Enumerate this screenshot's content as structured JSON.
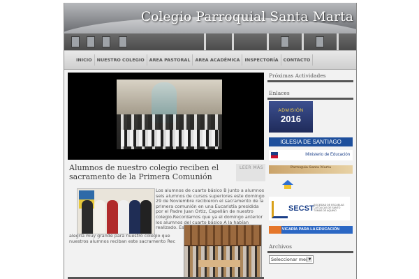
{
  "site": {
    "title": "Colegio Parroquial Santa Marta"
  },
  "nav": {
    "items": [
      "INICIO",
      "NUESTRO COLEGIO",
      "AREA PASTORAL",
      "AREA ACADÉMICA",
      "INSPECTORÍA",
      "CONTACTO"
    ]
  },
  "post": {
    "title": "Alumnos de nuestro colegio reciben el sacramento de la Primera Comunión",
    "read_more": "LEER MÁS",
    "body": "Los alumnos de cuarto básico B junto a alumnos seis alumnos de cursos superiores este domingo 29 de Noviembre recibieron el sacramento de la primera comunión en una Eucaristía presidida por el Padre Juan Ortiz, Capellán de nuestro colegio.Recordamos que ya el domingo anterior los alumnos del cuarto básico A la habían realizado. Es una",
    "caption": "alegría muy grande para nuestro colegio que nuestros alumnos reciban  este sacramento Rec"
  },
  "sidebar": {
    "proximas_title": "Próximas Actividades",
    "enlaces_title": "Enlaces",
    "archivos_title": "Archivos",
    "archive_select": "Seleccionar mes",
    "banners": {
      "admision_line1": "ADMISIÓN",
      "admision_line2": "2016",
      "iglesia": "IGLESIA DE SANTIAGO",
      "mineduc": "Ministerio de Educación",
      "parroquia": "Parroquia Santa Marta",
      "secst": "SECST",
      "secst_sub": "SOCIEDAD DE ESCUELAS CATÓLICAS DE SANTO TOMÁS DE AQUINO",
      "vicaria": "VICARÍA PARA LA EDUCACIÓN"
    }
  },
  "colors": {
    "header_text": "#ffffff",
    "nav_bg": "#dcdcdc",
    "accent_dark": "#555555"
  }
}
